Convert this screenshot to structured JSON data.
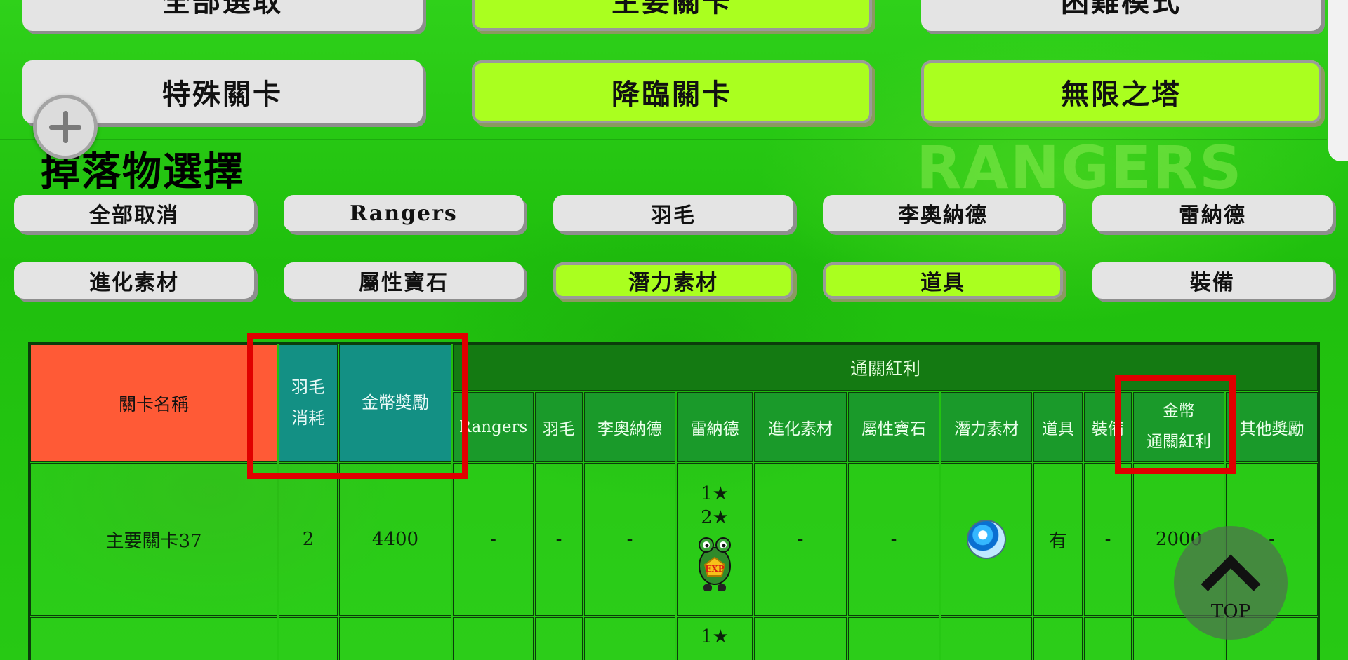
{
  "stage_buttons": {
    "row1": [
      {
        "label": "全部選取",
        "active": false
      },
      {
        "label": "主要關卡",
        "active": true
      },
      {
        "label": "困難模式",
        "active": false
      }
    ],
    "row2": [
      {
        "label": "特殊關卡",
        "active": false
      },
      {
        "label": "降臨關卡",
        "active": true
      },
      {
        "label": "無限之塔",
        "active": true
      }
    ]
  },
  "background_logo": "RANGERS",
  "drop_section": {
    "title": "掉落物選擇",
    "row1": [
      {
        "label": "全部取消",
        "active": false
      },
      {
        "label": "Rangers",
        "active": false
      },
      {
        "label": "羽毛",
        "active": false
      },
      {
        "label": "李奧納德",
        "active": false
      },
      {
        "label": "雷納德",
        "active": false
      }
    ],
    "row2": [
      {
        "label": "進化素材",
        "active": false
      },
      {
        "label": "屬性寶石",
        "active": false
      },
      {
        "label": "潛力素材",
        "active": true
      },
      {
        "label": "道具",
        "active": true
      },
      {
        "label": "裝備",
        "active": false
      }
    ]
  },
  "table": {
    "headers": {
      "stage_name": "關卡名稱",
      "feather_cost_line1": "羽毛",
      "feather_cost_line2": "消耗",
      "coin_reward": "金幣獎勵",
      "clear_bonus": "通關紅利",
      "bonus_columns": [
        "Rangers",
        "羽毛",
        "李奧納德",
        "雷納德",
        "進化素材",
        "屬性寶石",
        "潛力素材",
        "道具",
        "裝備"
      ],
      "coin_bonus_line1": "金幣",
      "coin_bonus_line2": "通關紅利",
      "other_rewards": "其他獎勵"
    },
    "rows": [
      {
        "stage": "主要關卡37",
        "feather_cost": "2",
        "coin_reward": "4400",
        "rangers": "-",
        "feather": "-",
        "leonard": "-",
        "reynard_stars": [
          "1★",
          "2★"
        ],
        "reynard_icon": "exp-frog-icon",
        "evolution": "-",
        "gem": "-",
        "potential_icon": "potential-orb-icon",
        "item": "有",
        "equip": "-",
        "coin_bonus": "2000",
        "other": "-"
      },
      {
        "reynard_stars": [
          "1★"
        ]
      }
    ]
  },
  "top_button": {
    "label": "TOP"
  },
  "colors": {
    "background": "#21c40f",
    "active_button": "#aaff1f",
    "inactive_button": "#e4e4e4",
    "header_red": "#ff5a36",
    "header_teal": "#139084",
    "header_green": "#1a9a2a",
    "highlight_red": "#e00000"
  }
}
